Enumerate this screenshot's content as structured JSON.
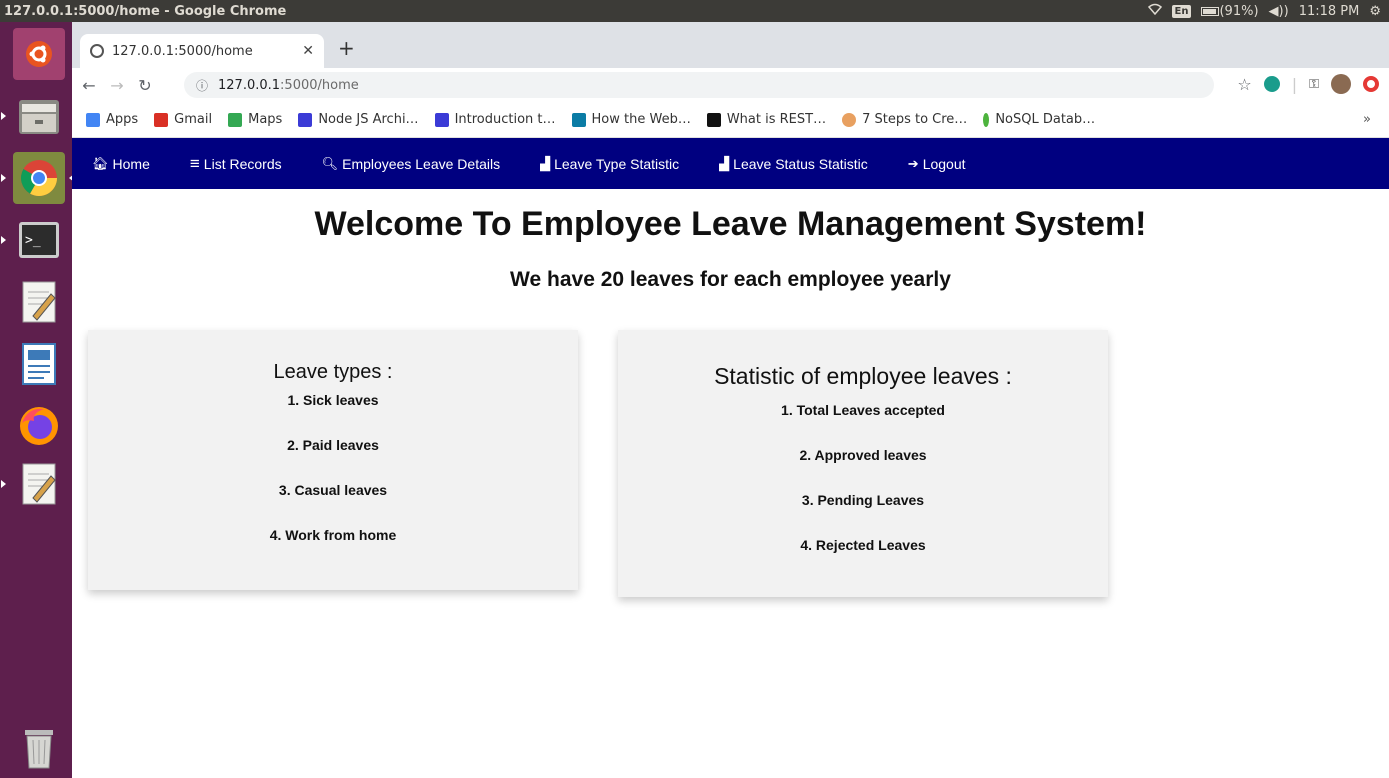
{
  "os": {
    "window_title": "127.0.0.1:5000/home - Google Chrome",
    "keyboard_layout": "En",
    "battery": "(91%)",
    "clock": "11:18 PM"
  },
  "launcher": {
    "items": [
      "ubuntu-icon",
      "files-icon",
      "chrome-icon",
      "terminal-icon",
      "text-editor-icon",
      "writer-icon",
      "firefox-icon",
      "text-editor-icon",
      "trash-icon"
    ]
  },
  "browser": {
    "tab_title": "127.0.0.1:5000/home",
    "url_host": "127.0.0.1",
    "url_path": ":5000/home",
    "bookmarks": [
      {
        "label": "Apps",
        "icon": "apps-grid-icon",
        "color": "#4285f4"
      },
      {
        "label": "Gmail",
        "icon": "gmail-icon",
        "color": "#d93025"
      },
      {
        "label": "Maps",
        "icon": "maps-icon",
        "color": "#34a853"
      },
      {
        "label": "Node JS Archi…",
        "icon": "dev-icon",
        "color": "#3b3bd6"
      },
      {
        "label": "Introduction t…",
        "icon": "dev-icon",
        "color": "#3b3bd6"
      },
      {
        "label": "How the Web…",
        "icon": "web-icon",
        "color": "#0b7ca5"
      },
      {
        "label": "What is REST…",
        "icon": "medium-icon",
        "color": "#111111"
      },
      {
        "label": "7 Steps to Cre…",
        "icon": "avatar-icon",
        "color": "#e8a060"
      },
      {
        "label": "NoSQL Datab…",
        "icon": "mongodb-leaf-icon",
        "color": "#4db33d"
      }
    ],
    "bookmarks_more": "»"
  },
  "app": {
    "nav_color": "#000080",
    "nav": [
      {
        "icon": "home-icon",
        "glyph": "🏠︎",
        "label": "Home"
      },
      {
        "icon": "list-icon",
        "glyph": "≡",
        "label": "List Records"
      },
      {
        "icon": "search-icon",
        "glyph": "🔍︎",
        "label": "Employees Leave Details"
      },
      {
        "icon": "area-chart-icon",
        "glyph": "▟",
        "label": "Leave Type Statistic"
      },
      {
        "icon": "area-chart-icon",
        "glyph": "▟",
        "label": "Leave Status Statistic"
      },
      {
        "icon": "logout-icon",
        "glyph": "➔",
        "label": "Logout"
      }
    ],
    "welcome": "Welcome To Employee Leave Management System!",
    "subline": "We have 20 leaves for each employee yearly",
    "leave_types": {
      "title": "Leave types :",
      "items": [
        "1. Sick leaves",
        "2. Paid leaves",
        "3. Casual leaves",
        "4. Work from home"
      ]
    },
    "statistics": {
      "title": "Statistic of employee leaves :",
      "items": [
        "1. Total Leaves accepted",
        "2. Approved leaves",
        "3. Pending Leaves",
        "4. Rejected Leaves"
      ]
    }
  }
}
